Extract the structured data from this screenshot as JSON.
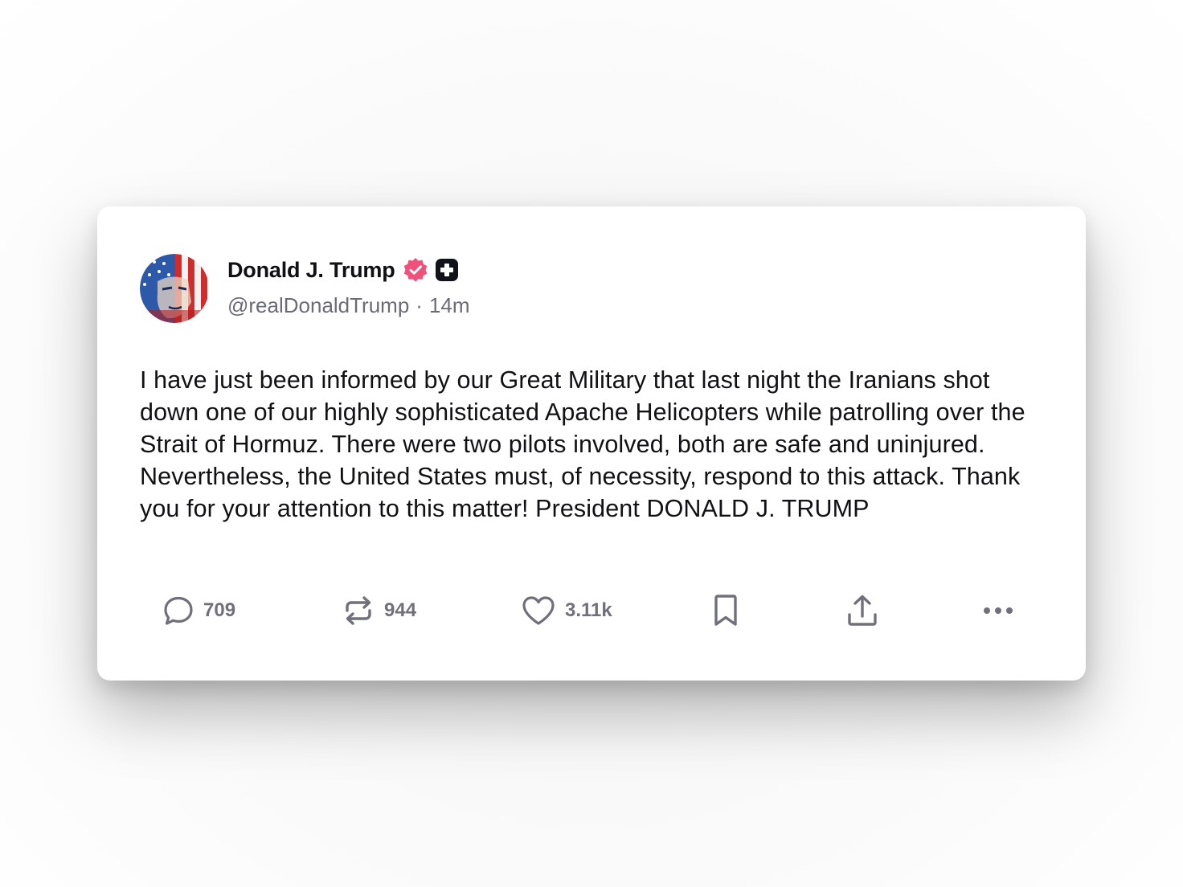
{
  "post": {
    "author": {
      "display_name": "Donald J. Trump",
      "handle": "@realDonaldTrump",
      "separator": "·",
      "timestamp": "14m",
      "verified_badge_color": "#f0507a",
      "plus_badge_color": "#12121a"
    },
    "text": "I have just been informed by our Great Military that last night the Iranians shot down one of our highly sophisticated Apache Helicopters while patrolling over the Strait of Hormuz. There were two pilots involved, both are safe and uninjured. Nevertheless, the United States must, of necessity, respond to this attack. Thank you for your attention to this matter! President DONALD J. TRUMP",
    "actions": {
      "reply": {
        "icon": "comment-icon",
        "count": "709"
      },
      "repost": {
        "icon": "repost-icon",
        "count": "944"
      },
      "like": {
        "icon": "heart-icon",
        "count": "3.11k"
      },
      "bookmark": {
        "icon": "bookmark-icon"
      },
      "share": {
        "icon": "share-icon"
      },
      "more": {
        "icon": "more-icon"
      }
    }
  },
  "colors": {
    "text_primary": "#111116",
    "text_secondary": "#6b6b78",
    "icon": "#70707c"
  }
}
